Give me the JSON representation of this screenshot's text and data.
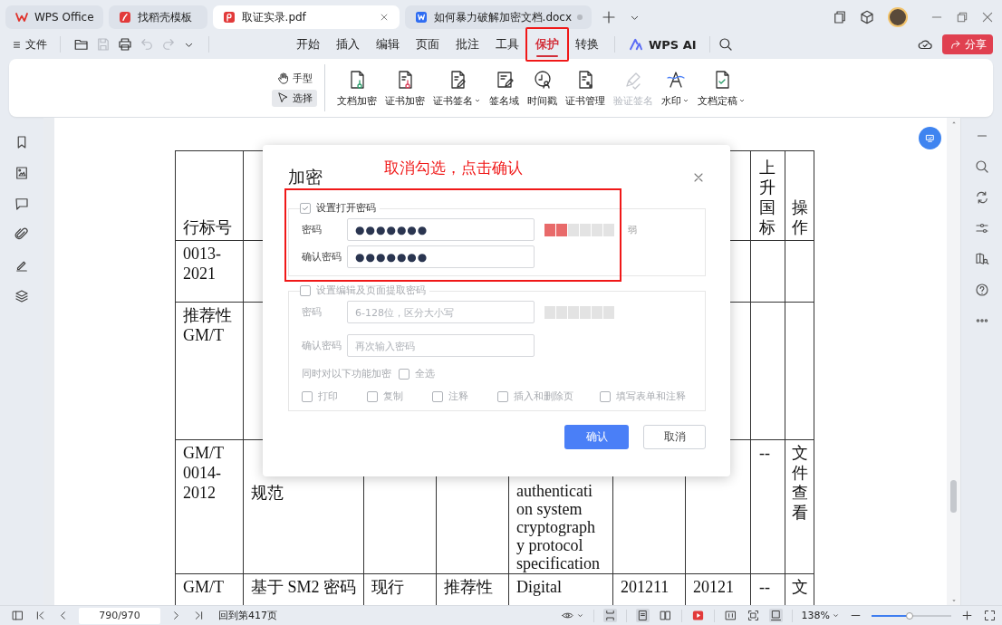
{
  "tabs": [
    {
      "kind": "home",
      "label": "WPS Office",
      "selected": false,
      "unsaved": false
    },
    {
      "kind": "template",
      "label": "找稻壳模板",
      "selected": false,
      "unsaved": false
    },
    {
      "kind": "pdf",
      "label": "取证实录.pdf",
      "selected": true,
      "unsaved": false
    },
    {
      "kind": "word",
      "label": "如何暴力破解加密文档.docx",
      "selected": false,
      "unsaved": true
    }
  ],
  "menu": {
    "file": "文件",
    "tabs": [
      {
        "label": "开始",
        "selected": false
      },
      {
        "label": "插入",
        "selected": false
      },
      {
        "label": "编辑",
        "selected": false
      },
      {
        "label": "页面",
        "selected": false
      },
      {
        "label": "批注",
        "selected": false
      },
      {
        "label": "工具",
        "selected": false
      },
      {
        "label": "保护",
        "selected": true
      },
      {
        "label": "转换",
        "selected": false
      }
    ],
    "ai": "WPS AI",
    "share": "分享"
  },
  "ribbon": {
    "modes": [
      {
        "kind": "hand",
        "label": "手型",
        "selected": false
      },
      {
        "kind": "pointer",
        "label": "选择",
        "selected": true
      }
    ],
    "tools": [
      {
        "kind": "encrypt",
        "label": "文档加密",
        "dropdown": false,
        "disabled": false
      },
      {
        "kind": "cert-encrypt",
        "label": "证书加密",
        "dropdown": false,
        "disabled": false
      },
      {
        "kind": "cert-sign",
        "label": "证书签名",
        "dropdown": true,
        "disabled": false
      },
      {
        "kind": "sign-field",
        "label": "签名域",
        "dropdown": false,
        "disabled": false
      },
      {
        "kind": "timestamp",
        "label": "时间戳",
        "dropdown": false,
        "disabled": false
      },
      {
        "kind": "cert-manage",
        "label": "证书管理",
        "dropdown": false,
        "disabled": false
      },
      {
        "kind": "verify",
        "label": "验证签名",
        "dropdown": false,
        "disabled": true
      },
      {
        "kind": "watermark",
        "label": "水印",
        "dropdown": true,
        "disabled": false
      },
      {
        "kind": "finalize",
        "label": "文档定稿",
        "dropdown": true,
        "disabled": false
      }
    ]
  },
  "document": {
    "table": {
      "rows": [
        {
          "column_1": "行标号",
          "column_8": "上升国标",
          "column_9": "操作"
        },
        {
          "column_1": "0013-\n2021"
        },
        {
          "column_1": "推荐性\nGM/T"
        },
        {
          "column_1": "GM/T\n0014-\n2012",
          "column_2": "规范",
          "column_5": "authenticati\non system\ncryptograph\ny protocol\nspecification",
          "column_8": "--",
          "column_9": "文件查看"
        },
        {
          "column_1": "GM/T",
          "column_2": "基于 SM2 密码",
          "column_3": "现行",
          "column_4": "推荐性",
          "column_5": "Digital",
          "column_6": "201211",
          "column_7": "20121",
          "column_8": "--",
          "column_9": "文"
        }
      ]
    }
  },
  "dialog": {
    "title": "加密",
    "note": "取消勾选，点击确认",
    "sections": [
      {
        "label": "设置打开密码",
        "checked": true,
        "disabled": false,
        "fields": [
          {
            "label": "密码",
            "value": "●●●●●●●",
            "strength": {
              "level": 0.33,
              "reading": "弱"
            }
          },
          {
            "label": "确认密码",
            "value": "●●●●●●●"
          }
        ]
      },
      {
        "label": "设置编辑及页面提取密码",
        "checked": false,
        "disabled": true,
        "fields": [
          {
            "label": "密码",
            "placeholder": "6-128位，区分大小写",
            "strength": {
              "level": 0
            }
          },
          {
            "label": "确认密码",
            "placeholder": "再次输入密码"
          }
        ],
        "extra": {
          "label": "同时对以下功能加密",
          "select_all": {
            "label": "全选",
            "checked": false
          },
          "options": [
            {
              "label": "打印",
              "checked": false
            },
            {
              "label": "复制",
              "checked": false
            },
            {
              "label": "注释",
              "checked": false
            },
            {
              "label": "插入和删除页",
              "checked": false
            },
            {
              "label": "填写表单和注释",
              "checked": false
            }
          ]
        }
      }
    ],
    "buttons": [
      {
        "kind": "primary",
        "label": "确认"
      },
      {
        "kind": "secondary",
        "label": "取消"
      }
    ]
  },
  "status_bar": {
    "page": "790/970",
    "back": "回到第417页",
    "zoom": "138%",
    "zoom_slider": {
      "level": 0.48
    }
  }
}
